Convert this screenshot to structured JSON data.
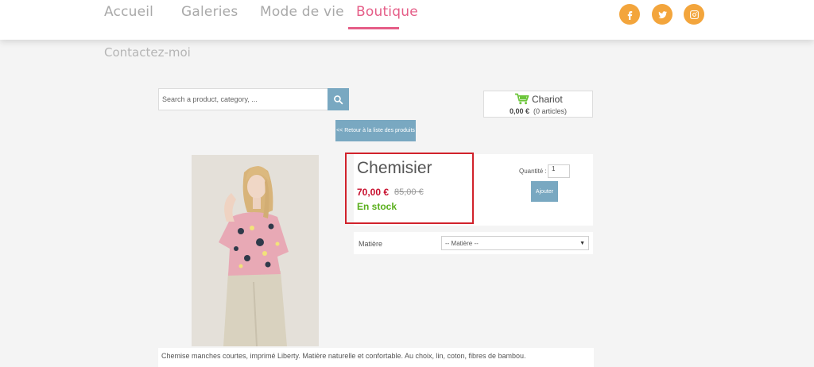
{
  "nav": {
    "items": [
      {
        "label": "Accueil"
      },
      {
        "label": "Galeries"
      },
      {
        "label": "Mode de vie"
      },
      {
        "label": "Boutique"
      }
    ],
    "active": "Boutique",
    "contact": "Contactez-moi",
    "social": [
      "facebook-icon",
      "twitter-icon",
      "instagram-icon"
    ]
  },
  "search": {
    "placeholder": "Search a product, category, ..."
  },
  "cart": {
    "title": "Chariot",
    "total": "0,00 €",
    "count": "(0 articles)"
  },
  "back_label": "<< Retour à la liste des produits",
  "product": {
    "title": "Chemisier",
    "price": "70,00 €",
    "old_price": "85,00 €",
    "stock": "En stock",
    "qty_label": "Quantité :",
    "qty_value": "1",
    "add_label": "Ajouter",
    "option_label": "Matière",
    "option_selected": "-- Matière --",
    "description": "Chemise manches courtes, imprimé Liberty. Matière naturelle et confortable. Au choix, lin, coton, fibres de bambou."
  },
  "colors": {
    "accent": "#e55d87",
    "button": "#79a8c1",
    "social": "#f3a53c",
    "price": "#c8102e",
    "stock": "#5aaf1c",
    "highlight": "#d1222b"
  }
}
